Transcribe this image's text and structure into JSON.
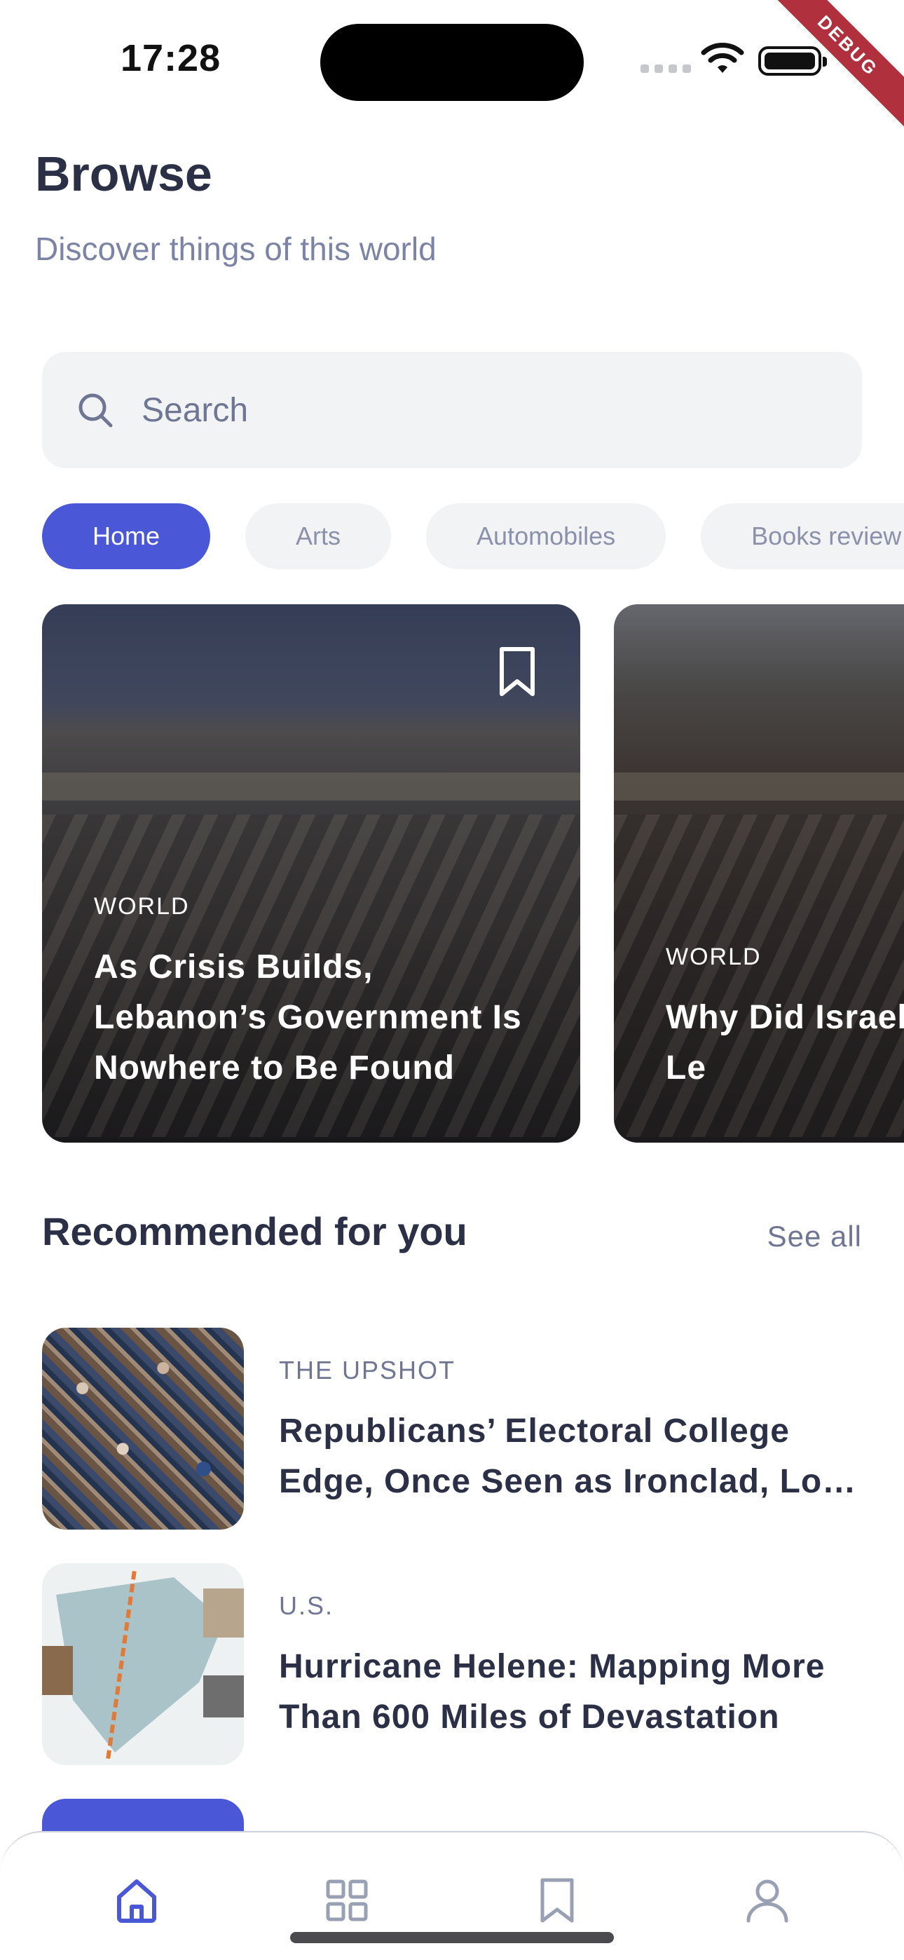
{
  "status_bar": {
    "time": "17:28",
    "debug_label": "DEBUG"
  },
  "header": {
    "title": "Browse",
    "subtitle": "Discover things of this world"
  },
  "search": {
    "placeholder": "Search",
    "value": ""
  },
  "categories": [
    "Home",
    "Arts",
    "Automobiles",
    "Books review"
  ],
  "selected_category": "Home",
  "featured": [
    {
      "category": "WORLD",
      "headline": "As Crisis Builds, Lebanon’s Government Is Nowhere to Be Found"
    },
    {
      "category": "WORLD",
      "headline": "Why Did Israel Troops Into Le"
    }
  ],
  "recommended": {
    "title": "Recommended for you",
    "see_all": "See all",
    "items": [
      {
        "category": "THE UPSHOT",
        "headline": "Republicans’ Electoral College Edge, Once Seen as Ironclad, Lo…"
      },
      {
        "category": "U.S.",
        "headline": "Hurricane Helene: Mapping More Than 600 Miles of Devastation"
      }
    ]
  },
  "bottom_nav": [
    {
      "icon": "home-icon",
      "active": true
    },
    {
      "icon": "grid-icon",
      "active": false
    },
    {
      "icon": "bookmark-icon",
      "active": false
    },
    {
      "icon": "user-icon",
      "active": false
    }
  ],
  "colors": {
    "accent": "#4a58d8",
    "text": "#2c3047",
    "muted": "#6f7693",
    "chip_bg": "#f2f3f5"
  }
}
